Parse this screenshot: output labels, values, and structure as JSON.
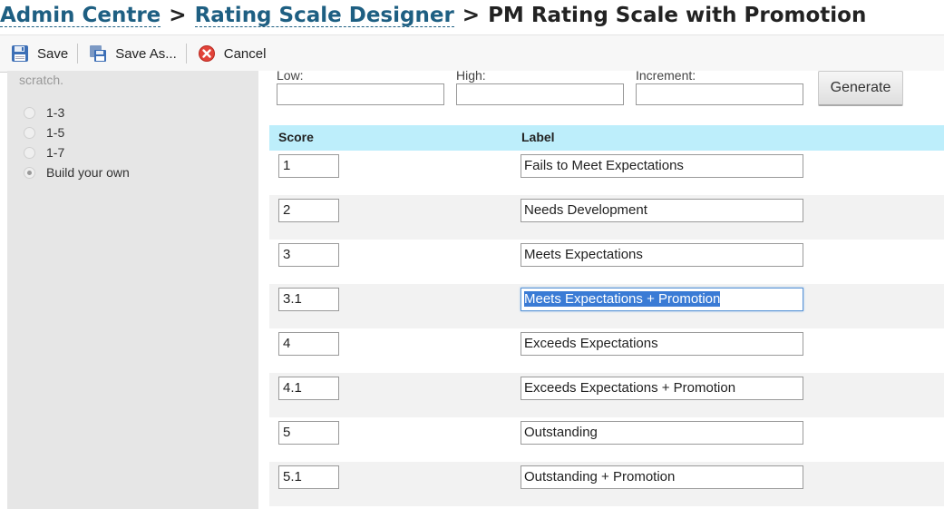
{
  "breadcrumb": {
    "items": [
      "Admin Centre",
      "Rating Scale Designer"
    ],
    "separator": ">",
    "current": "PM Rating Scale with Promotion"
  },
  "toolbar": {
    "save_label": "Save",
    "save_as_label": "Save As...",
    "cancel_label": "Cancel"
  },
  "sidebar": {
    "scratch_text": "scratch.",
    "options": [
      {
        "label": "1-3",
        "selected": false
      },
      {
        "label": "1-5",
        "selected": false
      },
      {
        "label": "1-7",
        "selected": false
      },
      {
        "label": "Build your own",
        "selected": true
      }
    ]
  },
  "generator": {
    "low_label": "Low:",
    "high_label": "High:",
    "increment_label": "Increment:",
    "low_value": "",
    "high_value": "",
    "increment_value": "",
    "generate_label": "Generate"
  },
  "table": {
    "score_header": "Score",
    "label_header": "Label",
    "rows": [
      {
        "score": "1",
        "label": "Fails to Meet Expectations"
      },
      {
        "score": "2",
        "label": "Needs Development"
      },
      {
        "score": "3",
        "label": "Meets Expectations"
      },
      {
        "score": "3.1",
        "label": "Meets Expectations + Promotion"
      },
      {
        "score": "4",
        "label": "Exceeds Expectations"
      },
      {
        "score": "4.1",
        "label": "Exceeds Expectations + Promotion"
      },
      {
        "score": "5",
        "label": "Outstanding"
      },
      {
        "score": "5.1",
        "label": "Outstanding + Promotion"
      }
    ]
  },
  "colors": {
    "link": "#1e5f82",
    "table_header_bg": "#bdeefb",
    "sidebar_bg": "#e6e6e6",
    "selection": "#3a7bd5"
  }
}
